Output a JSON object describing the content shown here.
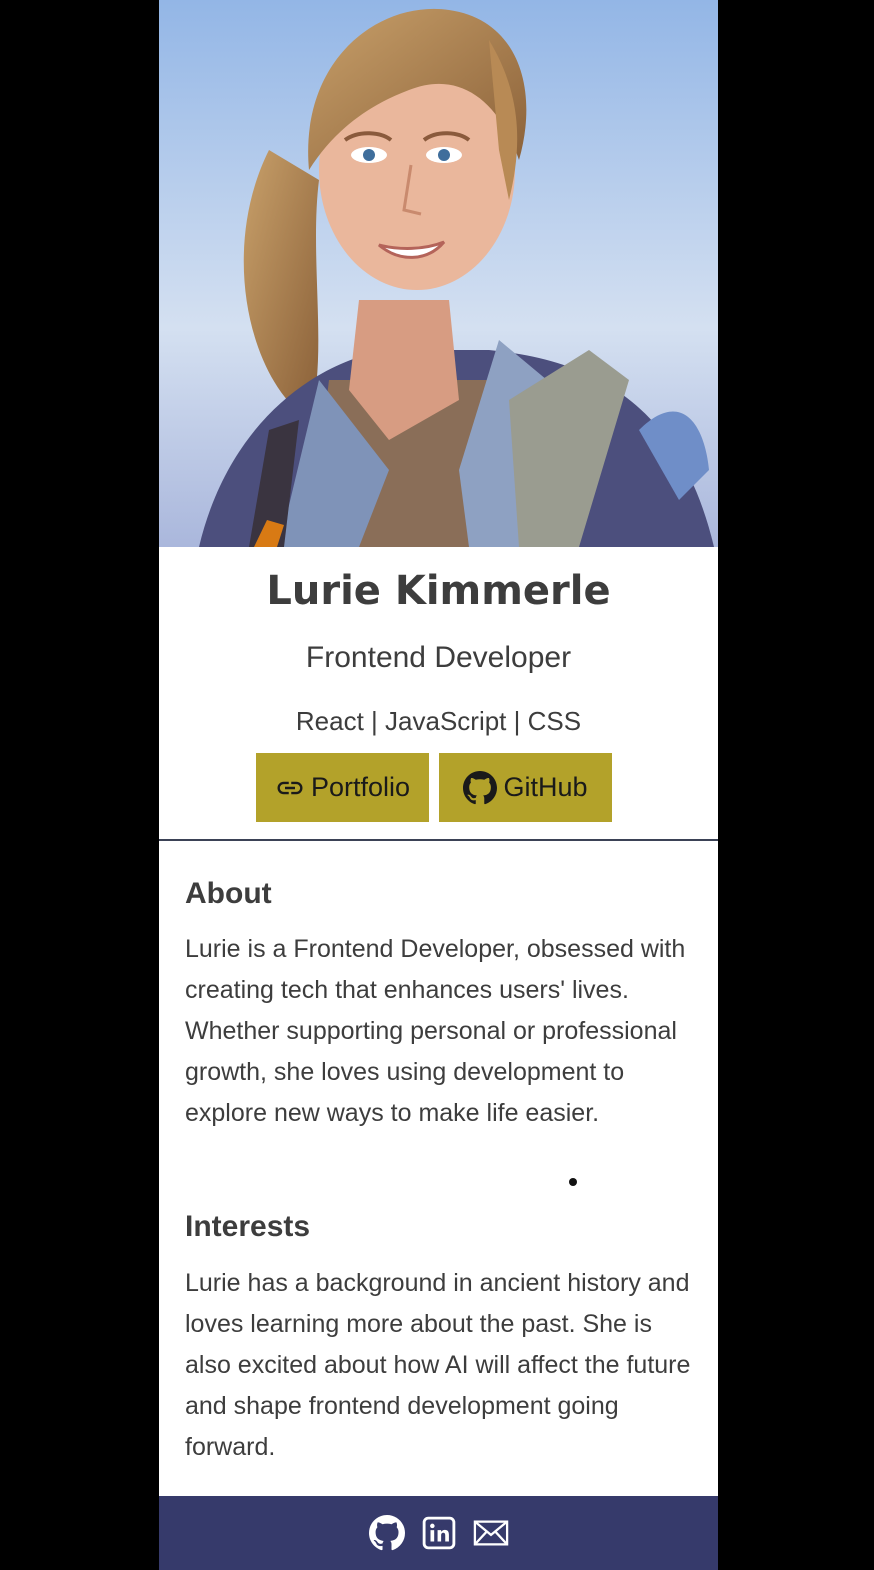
{
  "profile": {
    "name": "Lurie Kimmerle",
    "role": "Frontend Developer",
    "skills": "React | JavaScript | CSS"
  },
  "buttons": {
    "portfolio": {
      "label": "Portfolio",
      "icon": "link-icon"
    },
    "github": {
      "label": "GitHub",
      "icon": "github-icon"
    }
  },
  "about": {
    "title": "About",
    "text": "Lurie is a Frontend Developer, obsessed with creating tech that enhances users' lives. Whether supporting personal or professional growth, she loves using development to explore new ways to make life easier."
  },
  "interests": {
    "title": "Interests",
    "text": "Lurie has a background in ancient history and loves learning more about the past. She is also excited about how AI will affect the future and shape frontend development going forward."
  },
  "footer": {
    "icons": [
      "github-icon",
      "linkedin-icon",
      "mail-icon"
    ]
  },
  "colors": {
    "accent": "#b3a22a",
    "footer": "#363a6b",
    "text": "#3d3d3d",
    "page_background": "#000000"
  }
}
